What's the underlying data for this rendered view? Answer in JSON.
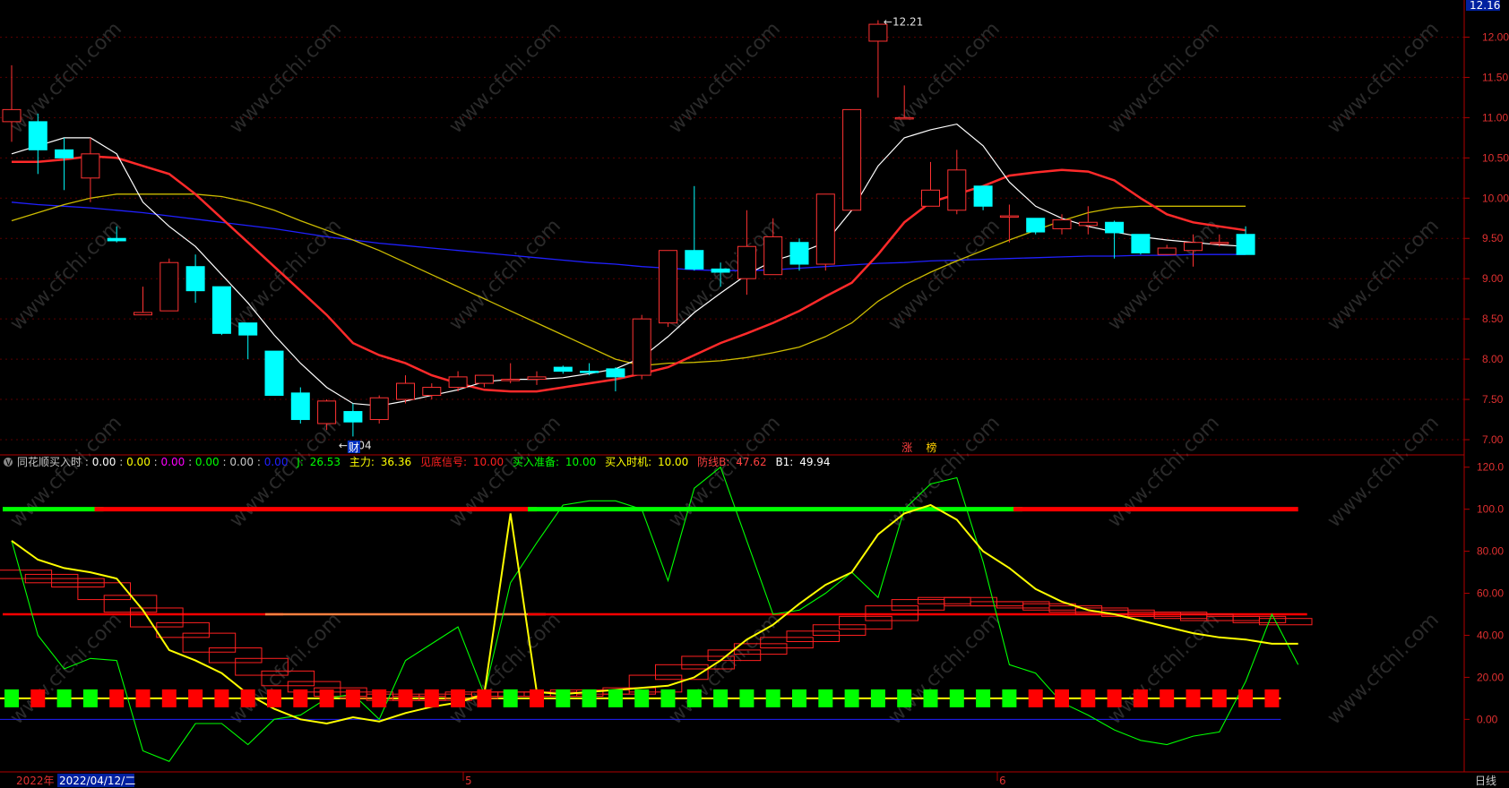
{
  "colors": {
    "up": "#ff3232",
    "down": "#00ffff",
    "ma5": "#ffffff",
    "ma10": "#ff2a2a",
    "ma20": "#ccbb00",
    "ma60": "#2020ff",
    "axis": "#b00000",
    "grid": "#5a0000",
    "green": "#00ff00",
    "yellow": "#ffff00",
    "red": "#ff0000"
  },
  "price_axis": {
    "labels": [
      "12.00",
      "11.50",
      "11.00",
      "10.50",
      "10.00",
      "9.50",
      "9.00",
      "8.50",
      "8.00",
      "7.50",
      "7.00"
    ],
    "current": "12.16"
  },
  "indicator_axis": {
    "labels": [
      "120.0",
      "100.0",
      "80.00",
      "60.00",
      "40.00",
      "20.00",
      "0.00"
    ]
  },
  "chart_data": {
    "type": "candlestick",
    "price_ylim": [
      6.9,
      12.35
    ],
    "candles": [
      {
        "o": 10.95,
        "h": 11.65,
        "l": 10.7,
        "c": 11.1
      },
      {
        "o": 10.95,
        "h": 11.05,
        "l": 10.3,
        "c": 10.6
      },
      {
        "o": 10.6,
        "h": 10.75,
        "l": 10.1,
        "c": 10.5
      },
      {
        "o": 10.25,
        "h": 10.75,
        "l": 9.95,
        "c": 10.55
      },
      {
        "o": 9.5,
        "h": 9.65,
        "l": 9.45,
        "c": 9.47
      },
      {
        "o": 8.55,
        "h": 8.9,
        "l": 8.55,
        "c": 8.58
      },
      {
        "o": 8.6,
        "h": 9.25,
        "l": 8.6,
        "c": 9.2
      },
      {
        "o": 9.15,
        "h": 9.3,
        "l": 8.7,
        "c": 8.85
      },
      {
        "o": 8.9,
        "h": 8.9,
        "l": 8.3,
        "c": 8.32
      },
      {
        "o": 8.45,
        "h": 8.45,
        "l": 8.0,
        "c": 8.3
      },
      {
        "o": 8.1,
        "h": 8.1,
        "l": 7.55,
        "c": 7.55
      },
      {
        "o": 7.58,
        "h": 7.65,
        "l": 7.2,
        "c": 7.25
      },
      {
        "o": 7.2,
        "h": 7.5,
        "l": 7.12,
        "c": 7.48
      },
      {
        "o": 7.35,
        "h": 7.45,
        "l": 7.04,
        "c": 7.22
      },
      {
        "o": 7.25,
        "h": 7.55,
        "l": 7.2,
        "c": 7.52
      },
      {
        "o": 7.5,
        "h": 7.8,
        "l": 7.45,
        "c": 7.7
      },
      {
        "o": 7.55,
        "h": 7.7,
        "l": 7.5,
        "c": 7.65
      },
      {
        "o": 7.65,
        "h": 7.85,
        "l": 7.6,
        "c": 7.78
      },
      {
        "o": 7.7,
        "h": 7.8,
        "l": 7.65,
        "c": 7.8
      },
      {
        "o": 7.75,
        "h": 7.95,
        "l": 7.7,
        "c": 7.75
      },
      {
        "o": 7.75,
        "h": 7.85,
        "l": 7.68,
        "c": 7.78
      },
      {
        "o": 7.9,
        "h": 7.92,
        "l": 7.82,
        "c": 7.85
      },
      {
        "o": 7.85,
        "h": 7.95,
        "l": 7.8,
        "c": 7.84
      },
      {
        "o": 7.88,
        "h": 7.9,
        "l": 7.6,
        "c": 7.78
      },
      {
        "o": 7.8,
        "h": 8.55,
        "l": 7.75,
        "c": 8.5
      },
      {
        "o": 8.45,
        "h": 9.35,
        "l": 8.4,
        "c": 9.35
      },
      {
        "o": 9.35,
        "h": 10.15,
        "l": 9.1,
        "c": 9.12
      },
      {
        "o": 9.12,
        "h": 9.2,
        "l": 8.9,
        "c": 9.08
      },
      {
        "o": 9.0,
        "h": 9.85,
        "l": 8.8,
        "c": 9.4
      },
      {
        "o": 9.05,
        "h": 9.75,
        "l": 9.05,
        "c": 9.52
      },
      {
        "o": 9.45,
        "h": 9.5,
        "l": 9.1,
        "c": 9.18
      },
      {
        "o": 9.18,
        "h": 10.05,
        "l": 9.1,
        "c": 10.05
      },
      {
        "o": 9.85,
        "h": 11.1,
        "l": 9.85,
        "c": 11.1
      },
      {
        "o": 11.95,
        "h": 12.21,
        "l": 11.25,
        "c": 12.16
      },
      {
        "o": 11.0,
        "h": 11.4,
        "l": 11.0,
        "c": 11.0
      },
      {
        "o": 9.9,
        "h": 10.45,
        "l": 9.9,
        "c": 10.1
      },
      {
        "o": 9.85,
        "h": 10.6,
        "l": 9.8,
        "c": 10.35
      },
      {
        "o": 10.15,
        "h": 10.15,
        "l": 9.85,
        "c": 9.9
      },
      {
        "o": 9.78,
        "h": 9.92,
        "l": 9.45,
        "c": 9.78
      },
      {
        "o": 9.75,
        "h": 9.75,
        "l": 9.55,
        "c": 9.58
      },
      {
        "o": 9.62,
        "h": 9.8,
        "l": 9.55,
        "c": 9.73
      },
      {
        "o": 9.66,
        "h": 9.9,
        "l": 9.55,
        "c": 9.7
      },
      {
        "o": 9.7,
        "h": 9.72,
        "l": 9.25,
        "c": 9.57
      },
      {
        "o": 9.55,
        "h": 9.55,
        "l": 9.3,
        "c": 9.32
      },
      {
        "o": 9.3,
        "h": 9.42,
        "l": 9.3,
        "c": 9.38
      },
      {
        "o": 9.35,
        "h": 9.55,
        "l": 9.15,
        "c": 9.45
      },
      {
        "o": 9.45,
        "h": 9.55,
        "l": 9.4,
        "c": 9.45
      },
      {
        "o": 9.55,
        "h": 9.65,
        "l": 9.3,
        "c": 9.3
      }
    ],
    "ma5": [
      10.55,
      10.65,
      10.75,
      10.75,
      10.55,
      9.95,
      9.65,
      9.4,
      9.05,
      8.7,
      8.3,
      7.95,
      7.65,
      7.45,
      7.42,
      7.48,
      7.55,
      7.62,
      7.72,
      7.75,
      7.75,
      7.77,
      7.82,
      7.88,
      8.02,
      8.28,
      8.58,
      8.82,
      9.05,
      9.22,
      9.32,
      9.45,
      9.85,
      10.4,
      10.75,
      10.85,
      10.92,
      10.65,
      10.2,
      9.9,
      9.75,
      9.65,
      9.58,
      9.52,
      9.48,
      9.45,
      9.42,
      9.4
    ],
    "ma10": [
      10.45,
      10.45,
      10.48,
      10.52,
      10.5,
      10.4,
      10.3,
      10.05,
      9.75,
      9.45,
      9.15,
      8.85,
      8.55,
      8.2,
      8.05,
      7.95,
      7.8,
      7.7,
      7.62,
      7.6,
      7.6,
      7.65,
      7.7,
      7.75,
      7.82,
      7.9,
      8.05,
      8.2,
      8.32,
      8.45,
      8.6,
      8.78,
      8.95,
      9.3,
      9.7,
      9.95,
      10.05,
      10.15,
      10.28,
      10.32,
      10.35,
      10.33,
      10.22,
      10.0,
      9.8,
      9.7,
      9.65,
      9.6
    ],
    "ma20": [
      9.72,
      9.82,
      9.92,
      10.0,
      10.05,
      10.05,
      10.05,
      10.05,
      10.02,
      9.95,
      9.85,
      9.72,
      9.6,
      9.48,
      9.35,
      9.2,
      9.05,
      8.9,
      8.75,
      8.6,
      8.45,
      8.3,
      8.15,
      8.0,
      7.92,
      7.95,
      7.96,
      7.98,
      8.02,
      8.08,
      8.15,
      8.28,
      8.45,
      8.72,
      8.92,
      9.08,
      9.22,
      9.35,
      9.48,
      9.6,
      9.72,
      9.82,
      9.88,
      9.9,
      9.9,
      9.9,
      9.9,
      9.9
    ],
    "ma60": [
      9.95,
      9.92,
      9.9,
      9.88,
      9.85,
      9.82,
      9.78,
      9.74,
      9.7,
      9.66,
      9.62,
      9.57,
      9.52,
      9.48,
      9.44,
      9.41,
      9.38,
      9.35,
      9.32,
      9.29,
      9.26,
      9.23,
      9.2,
      9.18,
      9.15,
      9.13,
      9.11,
      9.1,
      9.1,
      9.11,
      9.13,
      9.15,
      9.17,
      9.19,
      9.2,
      9.22,
      9.23,
      9.24,
      9.25,
      9.26,
      9.27,
      9.28,
      9.28,
      9.29,
      9.29,
      9.3,
      9.3,
      9.3
    ],
    "annotations": {
      "low": "7.04",
      "high": "12.21",
      "cai_marker": "财",
      "zhang_marker": "涨",
      "bang_marker": "榜"
    },
    "indicator": {
      "ylim": [
        -25,
        125
      ],
      "yellow_line": [
        85,
        76,
        72,
        70,
        67,
        52,
        33,
        28,
        22,
        12,
        5,
        0,
        -2,
        1,
        -1,
        3,
        6,
        8,
        12,
        98,
        13,
        12,
        13,
        14,
        15,
        16,
        20,
        28,
        38,
        45,
        55,
        64,
        70,
        88,
        98,
        102,
        95,
        80,
        72,
        62,
        56,
        52,
        50,
        47,
        44,
        41,
        39,
        38,
        36,
        36
      ],
      "green_line": [
        85,
        40,
        24,
        29,
        28,
        -15,
        -20,
        -2,
        -2,
        -12,
        0,
        2,
        10,
        12,
        0,
        28,
        36,
        44,
        12,
        65,
        84,
        102,
        104,
        104,
        100,
        66,
        110,
        120,
        85,
        50,
        52,
        60,
        70,
        58,
        100,
        112,
        115,
        75,
        26,
        22,
        8,
        2,
        -5,
        -10,
        -12,
        -8,
        -6,
        18,
        50,
        26
      ],
      "bar_y": 10,
      "bar_colors": [
        "g",
        "r",
        "g",
        "g",
        "r",
        "r",
        "r",
        "r",
        "r",
        "r",
        "r",
        "r",
        "r",
        "r",
        "r",
        "r",
        "r",
        "r",
        "r",
        "g",
        "r",
        "g",
        "g",
        "g",
        "g",
        "g",
        "g",
        "g",
        "g",
        "g",
        "g",
        "g",
        "g",
        "g",
        "g",
        "g",
        "g",
        "g",
        "g",
        "r",
        "r",
        "r",
        "r",
        "r",
        "r",
        "r",
        "r",
        "r",
        "r"
      ],
      "top_line_segments": [
        {
          "from": 0,
          "to": 3.5,
          "color": "green"
        },
        {
          "from": 3.5,
          "to": 20,
          "color": "red"
        },
        {
          "from": 20,
          "to": 38.5,
          "color": "green"
        },
        {
          "from": 38.5,
          "to": 49,
          "color": "red"
        }
      ],
      "mid_line_segments": [
        {
          "from": 0,
          "to": 10,
          "color": "red"
        },
        {
          "from": 10,
          "to": 20,
          "color": "orange"
        },
        {
          "from": 20,
          "to": 49,
          "color": "red"
        }
      ],
      "staircase": [
        70,
        68,
        66,
        64,
        58,
        52,
        45,
        40,
        33,
        28,
        22,
        17,
        14,
        12,
        11,
        10,
        10,
        11,
        12,
        12,
        12,
        12,
        13,
        13,
        14,
        20,
        25,
        29,
        32,
        35,
        38,
        41,
        44,
        48,
        53,
        56,
        57,
        55,
        55,
        54,
        53,
        52,
        51,
        50,
        50,
        49,
        48,
        48,
        47
      ]
    }
  },
  "indicator_header": {
    "name": "同花顺买入时",
    "v1": "0.00",
    "v2": "0.00",
    "v3": "0.00",
    "v4": "0.00",
    "v5": "0.00",
    "v6": "0.00",
    "j_label": "J:",
    "j": "26.53",
    "zhuli_label": "主力:",
    "zhuli": "36.36",
    "jiandi_label": "见底信号:",
    "jiandi": "10.00",
    "mairu_zhunbei_label": "买入准备:",
    "mairu_zhunbei": "10.00",
    "mairu_shiji_label": "买入时机:",
    "mairu_shiji": "10.00",
    "fangxian_label": "防线B:",
    "fangxian": "47.62",
    "b1_label": "B1:",
    "b1": "49.94"
  },
  "bottom_bar": {
    "year": "2022年",
    "date": "2022/04/12/二",
    "month5": "5",
    "month6": "6",
    "period": "日线"
  },
  "watermark": "www.cfchi.com"
}
